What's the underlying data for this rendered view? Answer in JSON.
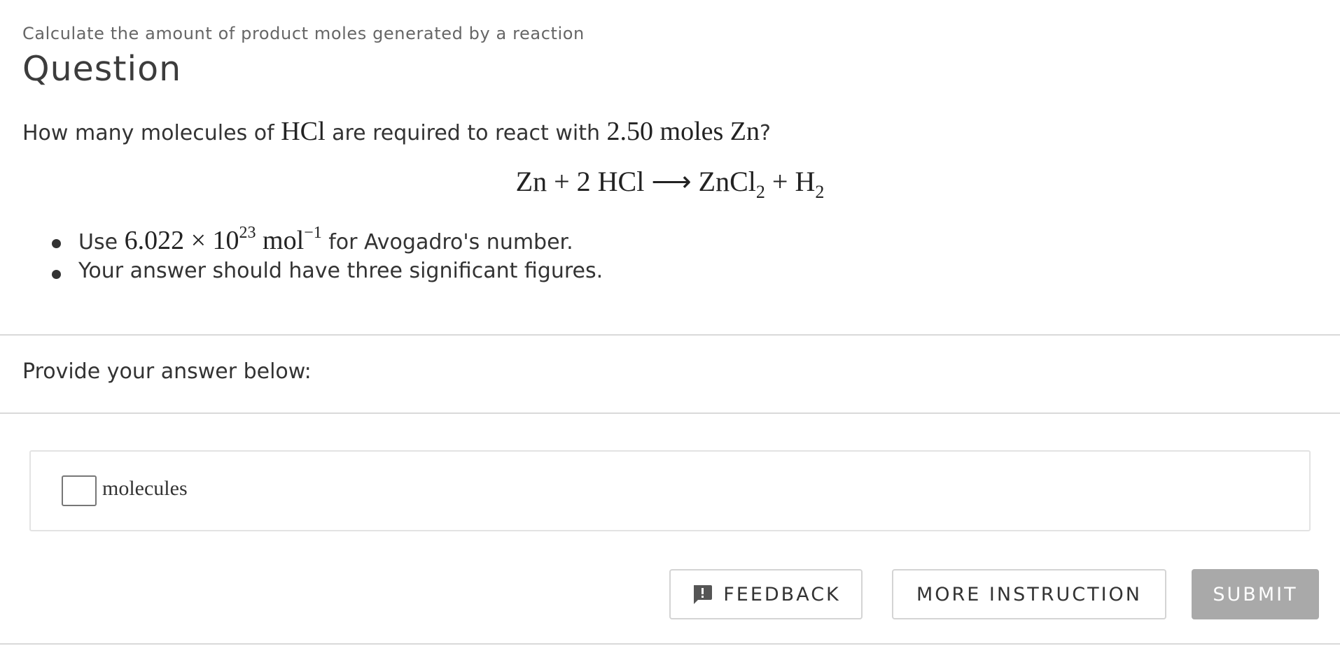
{
  "header": {
    "breadcrumb": "Calculate the amount of product moles generated by a reaction",
    "title": "Question"
  },
  "question": {
    "prompt_prefix": "How many molecules of ",
    "prompt_hcl": "HCl",
    "prompt_middle": " are required to react with ",
    "prompt_amount": "2.50 moles Zn",
    "prompt_suffix": "?",
    "equation": {
      "zn": "Zn",
      "plus1": "+",
      "coef": "2",
      "hcl": "HCl",
      "arrow": "⟶",
      "zncl": "ZnCl",
      "zncl_sub": "2",
      "plus2": "+",
      "h": "H",
      "h_sub": "2"
    },
    "bullets": {
      "b1_prefix": "Use ",
      "b1_mantissa": "6.022 × 10",
      "b1_exp": "23",
      "b1_unit": " mol",
      "b1_unit_exp": "−1",
      "b1_suffix": " for Avogadro's number.",
      "b2": "Your answer should have three significant figures."
    }
  },
  "answer": {
    "label": "Provide your answer below:",
    "input_value": "",
    "unit": "molecules"
  },
  "actions": {
    "feedback_label": "FEEDBACK",
    "more_instruction_label": "MORE INSTRUCTION",
    "submit_label": "SUBMIT"
  },
  "colors": {
    "text": "#333333",
    "muted": "#666666",
    "border": "#d4d4d4",
    "submit_disabled": "#a9a9a9"
  },
  "icons": {
    "feedback": "feedback-icon"
  }
}
